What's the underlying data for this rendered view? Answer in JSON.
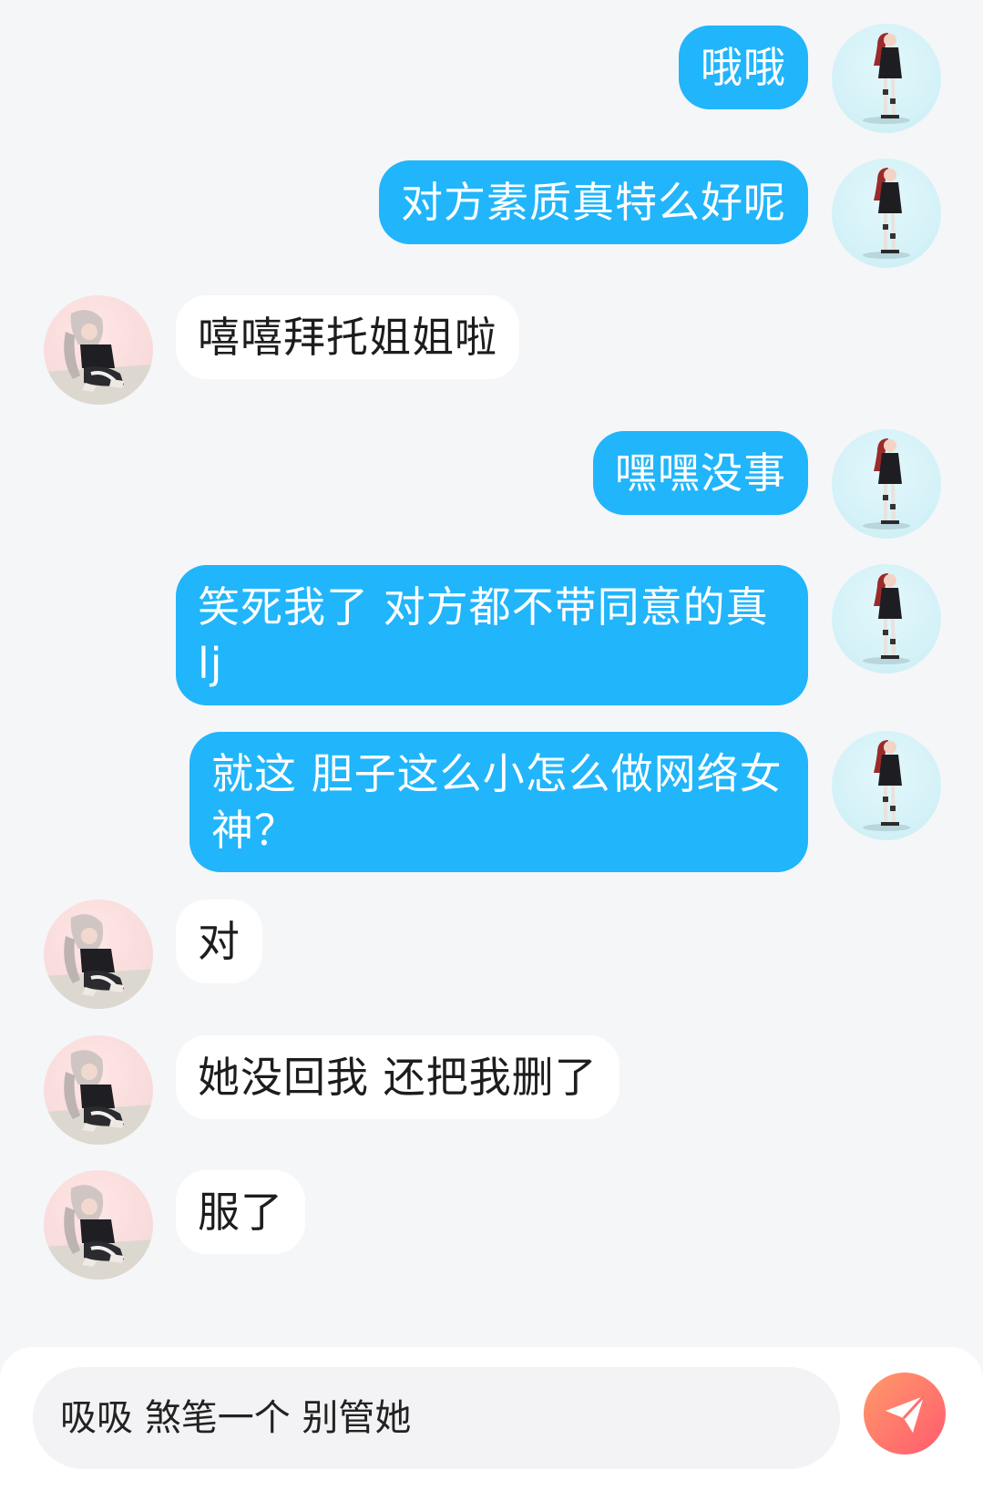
{
  "messages": [
    {
      "from": "me",
      "text": "哦哦"
    },
    {
      "from": "me",
      "text": "对方素质真特么好呢"
    },
    {
      "from": "them",
      "text": "嘻嘻拜托姐姐啦"
    },
    {
      "from": "me",
      "text": "嘿嘿没事"
    },
    {
      "from": "me",
      "text": "笑死我了 对方都不带同意的真lj"
    },
    {
      "from": "me",
      "text": "就这 胆子这么小怎么做网络女神？"
    },
    {
      "from": "them",
      "text": "对"
    },
    {
      "from": "them",
      "text": "她没回我 还把我删了"
    },
    {
      "from": "them",
      "text": "服了"
    }
  ],
  "composer": {
    "input_value": "吸吸 煞笔一个 别管她"
  },
  "colors": {
    "outgoing_bubble": "#21b5fb",
    "incoming_bubble": "#ffffff",
    "background": "#f5f6f8",
    "send_button_gradient": [
      "#ff9a6a",
      "#ff5b6e"
    ]
  },
  "icons": {
    "send": "paper-plane-icon"
  }
}
